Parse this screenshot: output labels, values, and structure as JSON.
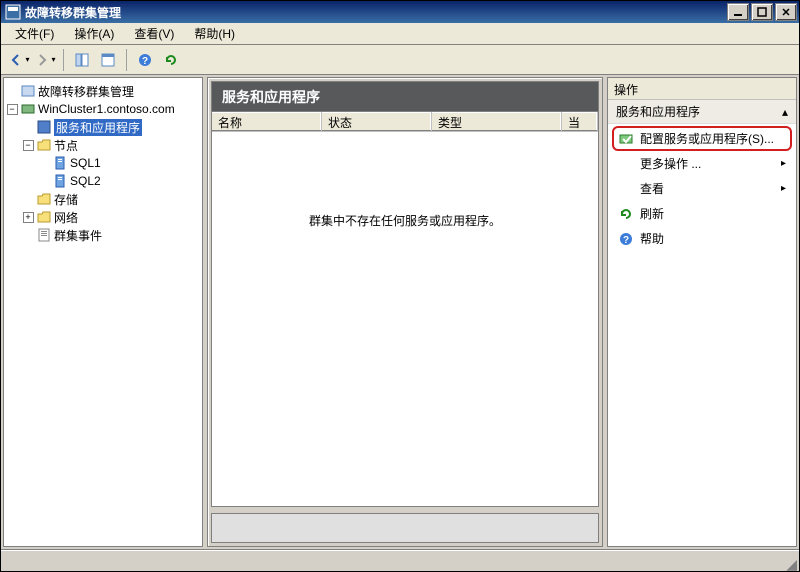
{
  "window": {
    "title": "故障转移群集管理"
  },
  "menubar": {
    "file": "文件(F)",
    "action": "操作(A)",
    "view": "查看(V)",
    "help": "帮助(H)"
  },
  "tree": {
    "root": "故障转移群集管理",
    "cluster": "WinCluster1.contoso.com",
    "services": "服务和应用程序",
    "nodes": "节点",
    "node1": "SQL1",
    "node2": "SQL2",
    "storage": "存储",
    "networks": "网络",
    "events": "群集事件"
  },
  "center": {
    "heading": "服务和应用程序",
    "columns": {
      "name": "名称",
      "status": "状态",
      "type": "类型",
      "extra": "当"
    },
    "empty_msg": "群集中不存在任何服务或应用程序。"
  },
  "actions": {
    "title": "操作",
    "section": "服务和应用程序",
    "items": {
      "configure": "配置服务或应用程序(S)...",
      "more": "更多操作 ...",
      "view": "查看",
      "refresh": "刷新",
      "help": "帮助"
    }
  }
}
